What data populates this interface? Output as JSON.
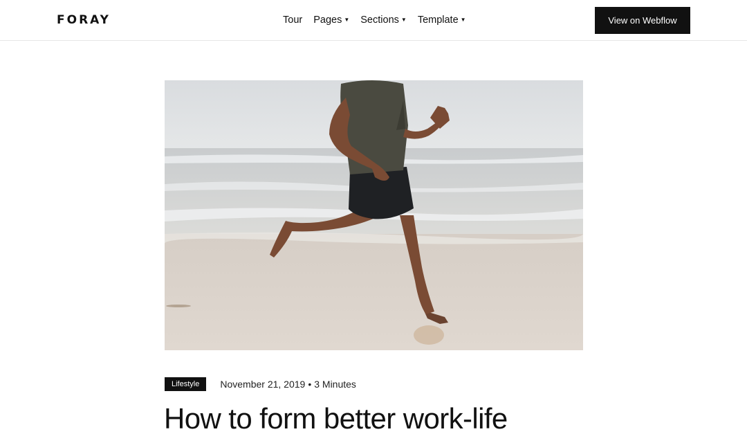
{
  "brand": {
    "logo": "FORAY"
  },
  "nav": {
    "items": [
      {
        "label": "Tour",
        "has_dropdown": false
      },
      {
        "label": "Pages",
        "has_dropdown": true
      },
      {
        "label": "Sections",
        "has_dropdown": true
      },
      {
        "label": "Template",
        "has_dropdown": true
      }
    ],
    "cta_label": "View on Webflow"
  },
  "post": {
    "hero_image_subject": "runner-on-beach",
    "category": "Lifestyle",
    "date": "November 21, 2019",
    "separator": "•",
    "read_time": "3 Minutes",
    "title": "How to form better work-life"
  },
  "colors": {
    "text": "#111111",
    "accent_dark": "#111111",
    "background": "#ffffff",
    "border": "#e6e6e6"
  }
}
